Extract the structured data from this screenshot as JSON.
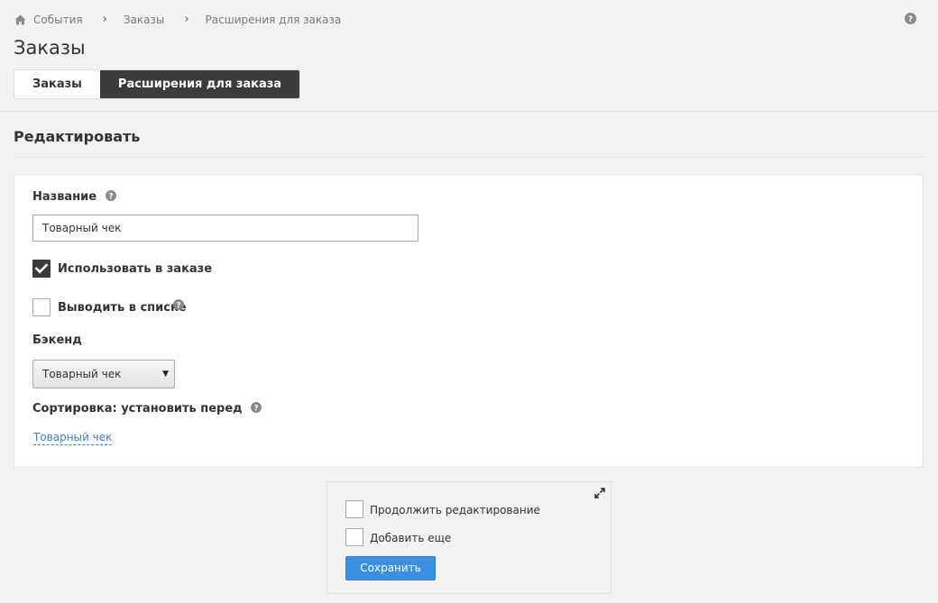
{
  "breadcrumb": {
    "items": [
      {
        "label": "События",
        "icon": "home-icon"
      },
      {
        "label": "Заказы"
      },
      {
        "label": "Расширения для заказа"
      }
    ]
  },
  "header": {
    "title": "Заказы",
    "help_icon": "question-circle-icon"
  },
  "tabs": [
    {
      "label": "Заказы",
      "active": false
    },
    {
      "label": "Расширения для заказа",
      "active": true
    }
  ],
  "section": {
    "title": "Редактировать"
  },
  "form": {
    "name": {
      "label": "Название",
      "value": "Товарный чек"
    },
    "use_in_order": {
      "label": "Использовать в заказе",
      "checked": true
    },
    "show_in_list": {
      "label": "Выводить в списке",
      "checked": false
    },
    "backend": {
      "label": "Бэкенд",
      "selected": "Товарный чек"
    },
    "sort": {
      "label": "Сортировка: установить перед",
      "link": "Товарный чек"
    }
  },
  "save_panel": {
    "continue_editing": {
      "label": "Продолжить редактирование",
      "checked": false
    },
    "add_more": {
      "label": "Добавить еще",
      "checked": false
    },
    "save_label": "Сохранить"
  },
  "colors": {
    "accent": "#3b8fe0",
    "link": "#3c7fc1",
    "tab_active": "#3c3c3c",
    "background": "#f3f1f2"
  }
}
